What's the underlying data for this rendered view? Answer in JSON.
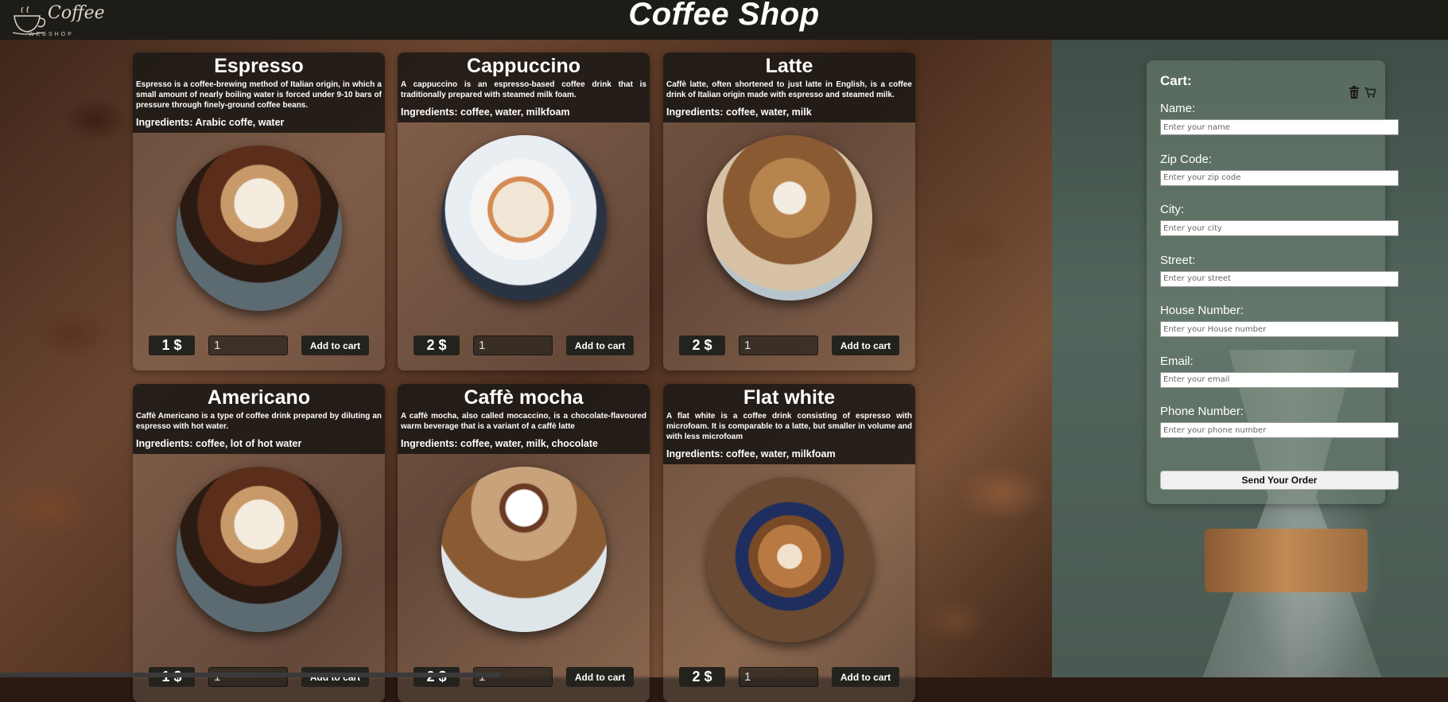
{
  "header": {
    "logo_text": "Coffee",
    "logo_sub": "WEBSHOP",
    "title": "Coffee Shop"
  },
  "products": [
    {
      "name": "Espresso",
      "description": "Espresso is a coffee-brewing method of Italian origin, in which a small amount of nearly boiling water is forced under 9-10 bars of pressure through finely-ground coffee beans.",
      "ingredients": "Ingredients: Arabic coffe, water",
      "price": "1 $",
      "quantity": "1",
      "add_label": "Add to cart"
    },
    {
      "name": "Cappuccino",
      "description": "A cappuccino is an espresso-based coffee drink that is traditionally prepared with steamed milk foam.",
      "ingredients": "Ingredients: coffee, water, milkfoam",
      "price": "2 $",
      "quantity": "1",
      "add_label": "Add to cart"
    },
    {
      "name": "Latte",
      "description": "Caffè latte, often shortened to just latte in English, is a coffee drink of Italian origin made with espresso and steamed milk.",
      "ingredients": "Ingredients: coffee, water, milk",
      "price": "2 $",
      "quantity": "1",
      "add_label": "Add to cart"
    },
    {
      "name": "Americano",
      "description": "Caffè Americano is a type of coffee drink prepared by diluting an espresso with hot water.",
      "ingredients": "Ingredients: coffee, lot of hot water",
      "price": "1 $",
      "quantity": "1",
      "add_label": "Add to cart"
    },
    {
      "name": "Caffè mocha",
      "description": "A caffè mocha, also called mocaccino, is a chocolate-flavoured warm beverage that is a variant of a caffè latte",
      "ingredients": "Ingredients: coffee, water, milk, chocolate",
      "price": "2 $",
      "quantity": "1",
      "add_label": "Add to cart"
    },
    {
      "name": "Flat white",
      "description": "A flat white is a coffee drink consisting of espresso with microfoam. It is comparable to a latte, but smaller in volume and with less microfoam",
      "ingredients": "Ingredients: coffee, water, milkfoam",
      "price": "2 $",
      "quantity": "1",
      "add_label": "Add to cart"
    }
  ],
  "cart": {
    "title": "Cart:",
    "fields": [
      {
        "label": "Name:",
        "placeholder": "Enter your name"
      },
      {
        "label": "Zip Code:",
        "placeholder": "Enter your zip code"
      },
      {
        "label": "City:",
        "placeholder": "Enter your city"
      },
      {
        "label": "Street:",
        "placeholder": "Enter your street"
      },
      {
        "label": "House Number:",
        "placeholder": "Enter your House number"
      },
      {
        "label": "Email:",
        "placeholder": "Enter your email"
      },
      {
        "label": "Phone Number:",
        "placeholder": "Enter your phone number"
      }
    ],
    "send_label": "Send Your Order",
    "icons": [
      "trash-icon",
      "cart-icon"
    ]
  }
}
